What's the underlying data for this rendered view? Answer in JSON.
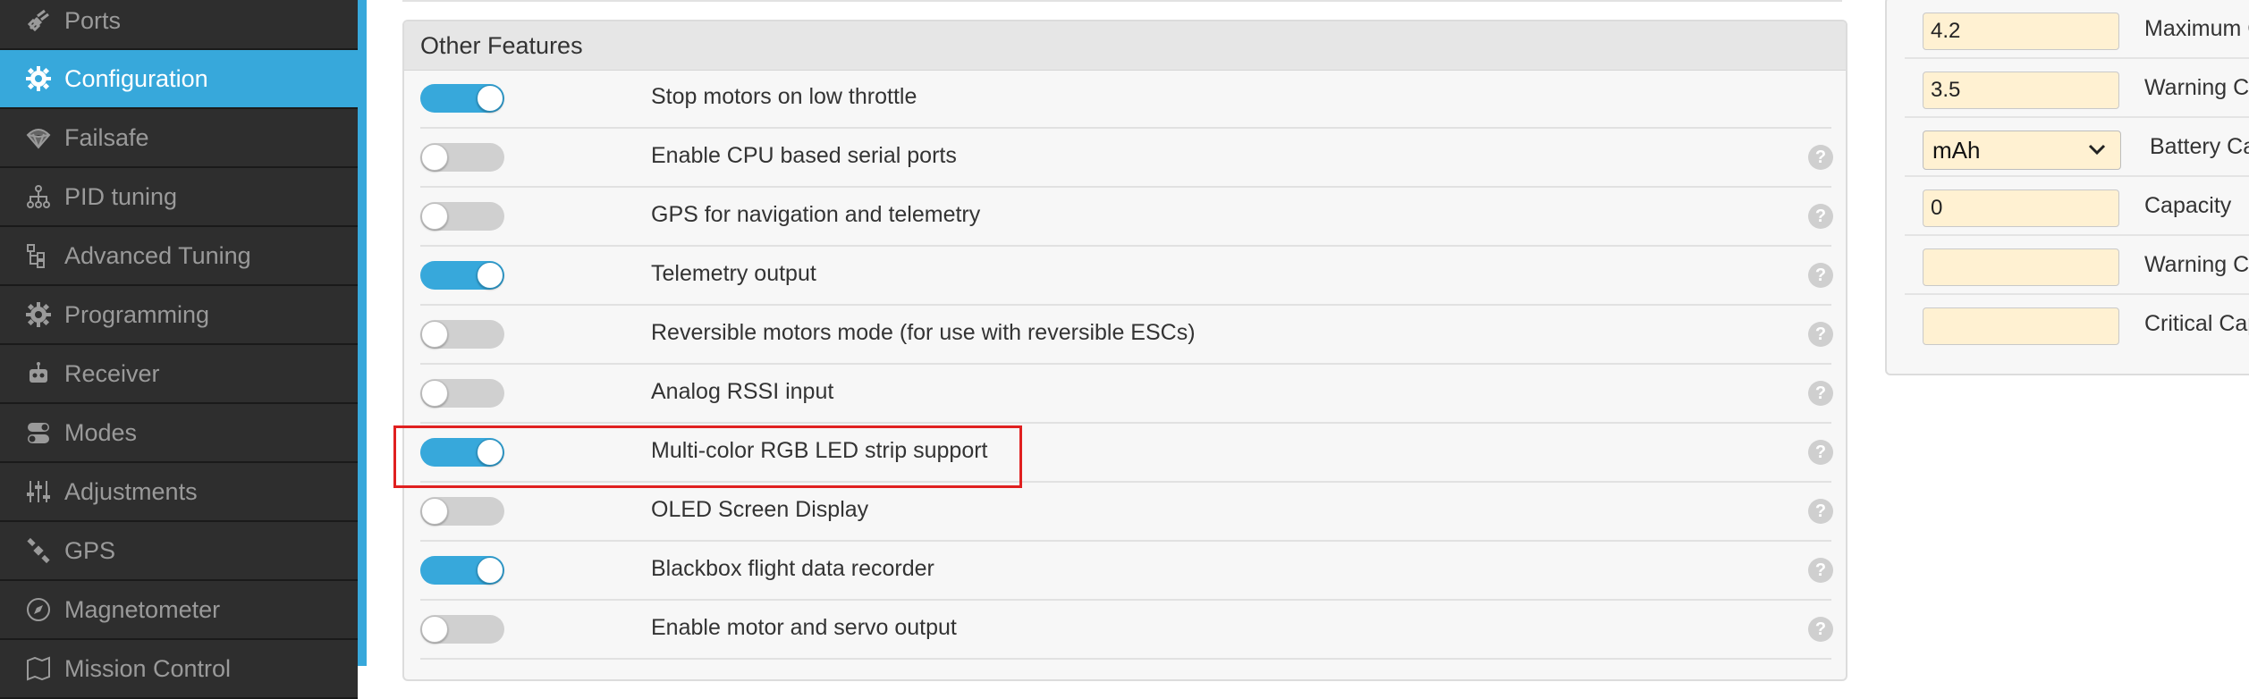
{
  "sidebar": {
    "items": [
      {
        "label": "Ports",
        "icon": "plug-icon",
        "active": false
      },
      {
        "label": "Configuration",
        "icon": "gear-icon",
        "active": true
      },
      {
        "label": "Failsafe",
        "icon": "parachute-icon",
        "active": false
      },
      {
        "label": "PID tuning",
        "icon": "hierarchy-icon",
        "active": false
      },
      {
        "label": "Advanced Tuning",
        "icon": "tree-icon",
        "active": false
      },
      {
        "label": "Programming",
        "icon": "gear-icon",
        "active": false
      },
      {
        "label": "Receiver",
        "icon": "robot-icon",
        "active": false
      },
      {
        "label": "Modes",
        "icon": "toggles-icon",
        "active": false
      },
      {
        "label": "Adjustments",
        "icon": "sliders-icon",
        "active": false
      },
      {
        "label": "GPS",
        "icon": "satellite-icon",
        "active": false
      },
      {
        "label": "Magnetometer",
        "icon": "compass-icon",
        "active": false
      },
      {
        "label": "Mission Control",
        "icon": "map-icon",
        "active": false
      }
    ]
  },
  "other_features": {
    "title": "Other Features",
    "features": [
      {
        "label": "Stop motors on low throttle",
        "enabled": true,
        "help": false
      },
      {
        "label": "Enable CPU based serial ports",
        "enabled": false,
        "help": true
      },
      {
        "label": "GPS for navigation and telemetry",
        "enabled": false,
        "help": true
      },
      {
        "label": "Telemetry output",
        "enabled": true,
        "help": true
      },
      {
        "label": "Reversible motors mode (for use with reversible ESCs)",
        "enabled": false,
        "help": true
      },
      {
        "label": "Analog RSSI input",
        "enabled": false,
        "help": true
      },
      {
        "label": "Multi-color RGB LED strip support",
        "enabled": true,
        "help": true
      },
      {
        "label": "OLED Screen Display",
        "enabled": false,
        "help": true
      },
      {
        "label": "Blackbox flight data recorder",
        "enabled": true,
        "help": true
      },
      {
        "label": "Enable motor and servo output",
        "enabled": false,
        "help": true
      }
    ],
    "help_glyph": "?"
  },
  "battery": {
    "rows": [
      {
        "type": "input",
        "value": "4.2",
        "label": "Maximum Ce"
      },
      {
        "type": "input",
        "value": "3.5",
        "label": "Warning Cell"
      },
      {
        "type": "select",
        "value": "mAh",
        "label": "Battery Cap"
      },
      {
        "type": "input",
        "value": "0",
        "label": "Capacity"
      },
      {
        "type": "input",
        "value": "",
        "label": "Warning Cap"
      },
      {
        "type": "input",
        "value": "",
        "label": "Critical Capa"
      }
    ]
  },
  "colors": {
    "accent": "#37a8db",
    "sidebar_bg": "#2e2e2e",
    "highlight": "#e02020",
    "input_bg": "#fff1d2"
  }
}
